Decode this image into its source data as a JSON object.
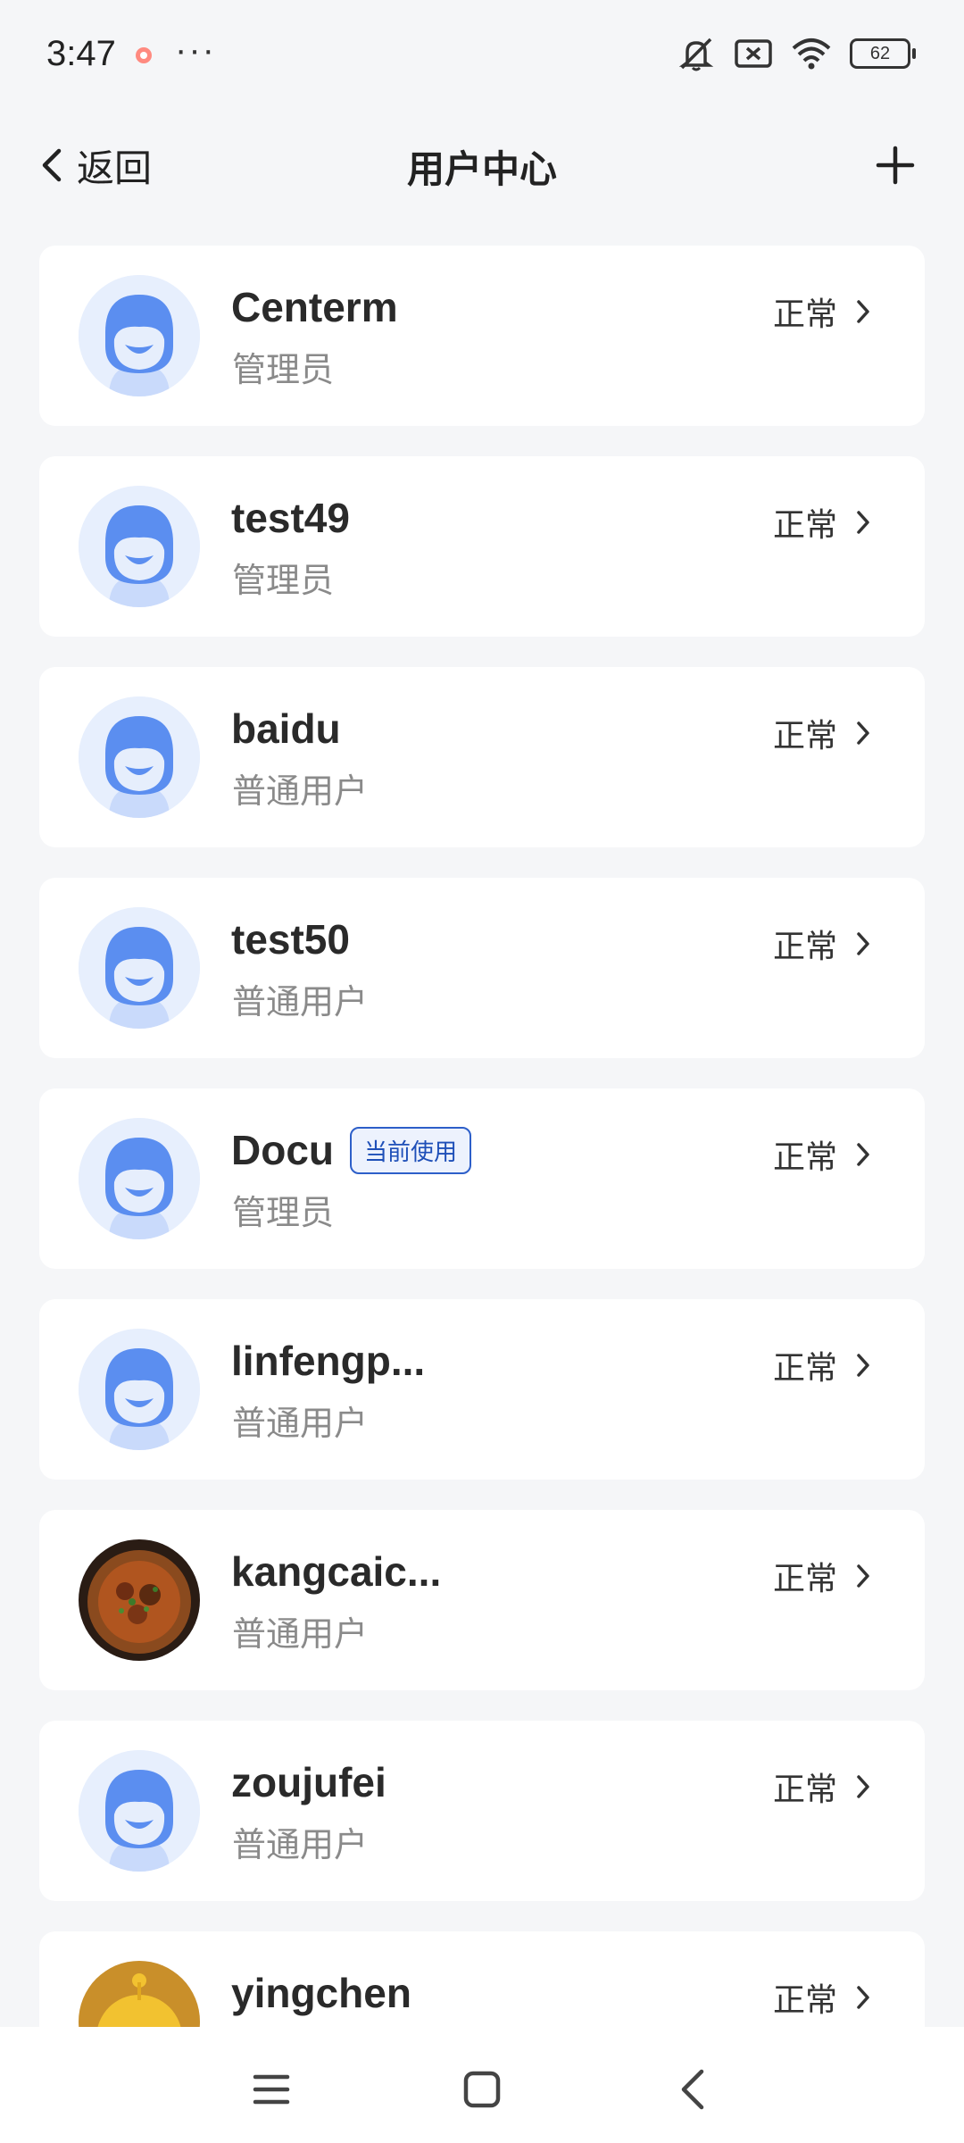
{
  "status_bar": {
    "time": "3:47",
    "more": "···",
    "battery": "62"
  },
  "nav": {
    "back_label": "返回",
    "title": "用户中心"
  },
  "users": [
    {
      "name": "Centerm",
      "role": "管理员",
      "status": "正常",
      "badge": "",
      "avatar": "default-avatar"
    },
    {
      "name": "test49",
      "role": "管理员",
      "status": "正常",
      "badge": "",
      "avatar": "default-avatar"
    },
    {
      "name": "baidu",
      "role": "普通用户",
      "status": "正常",
      "badge": "",
      "avatar": "default-avatar"
    },
    {
      "name": "test50",
      "role": "普通用户",
      "status": "正常",
      "badge": "",
      "avatar": "default-avatar"
    },
    {
      "name": "Docu",
      "role": "管理员",
      "status": "正常",
      "badge": "当前使用",
      "avatar": "default-avatar"
    },
    {
      "name": "linfengp...",
      "role": "普通用户",
      "status": "正常",
      "badge": "",
      "avatar": "default-avatar"
    },
    {
      "name": "kangcaic...",
      "role": "普通用户",
      "status": "正常",
      "badge": "",
      "avatar": "food-photo-avatar"
    },
    {
      "name": "zoujufei",
      "role": "普通用户",
      "status": "正常",
      "badge": "",
      "avatar": "default-avatar"
    },
    {
      "name": "yingchen",
      "role": "",
      "status": "正常",
      "badge": "",
      "avatar": "yellow-character-avatar"
    }
  ],
  "colors": {
    "accent": "#2d5fc9",
    "avatar_blue": "#5b8ef0",
    "background": "#f5f6f8"
  }
}
